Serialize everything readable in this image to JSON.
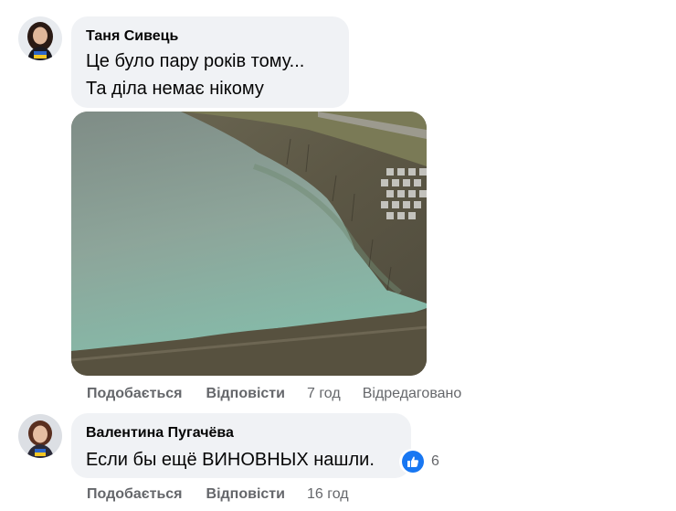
{
  "comments": [
    {
      "author": "Таня Сивець",
      "lines": [
        "Це було пару років тому...",
        "Та діла немає нікому"
      ],
      "actions": {
        "like": "Подобається",
        "reply": "Відповісти",
        "time": "7 год",
        "edited": "Відредаговано"
      }
    },
    {
      "author": "Валентина Пугачёва",
      "lines": [
        "Если бы ещё ВИНОВНЫХ нашли."
      ],
      "reaction": {
        "icon": "like-icon",
        "count": "6",
        "color": "#1877f2"
      },
      "actions": {
        "like": "Подобається",
        "reply": "Відповісти",
        "time": "16 год"
      }
    }
  ],
  "colors": {
    "bubble": "#f0f2f5",
    "secondary_text": "#65676b",
    "like_blue": "#1877f2"
  }
}
